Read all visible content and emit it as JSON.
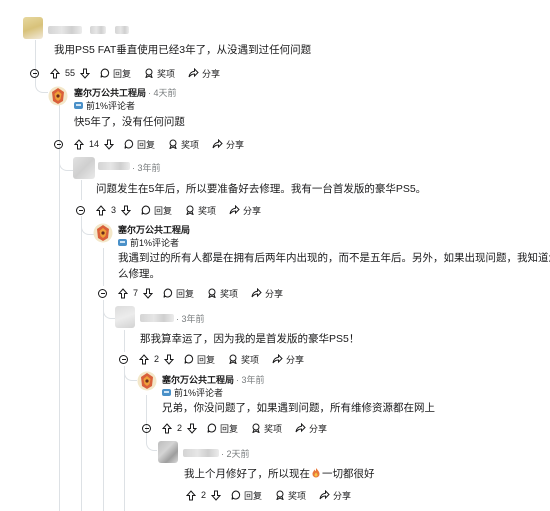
{
  "labels": {
    "reply": "回复",
    "award": "奖项",
    "share": "分享"
  },
  "comments": [
    {
      "id": "c1",
      "user": "",
      "time": "",
      "badge": "",
      "text": "我用PS5 FAT垂直使用已经3年了，从没遇到过任何问题",
      "votes": "55"
    },
    {
      "id": "c2",
      "user": "塞尔万公共工程局",
      "time": "· 4天前",
      "badge": "前1%评论者",
      "text": "快5年了，没有任何问题",
      "votes": "14"
    },
    {
      "id": "c3",
      "user": "",
      "time": "· 3年前",
      "badge": "",
      "text": "问题发生在5年后，所以要准备好去修理。我有一台首发版的豪华PS5。",
      "votes": "3"
    },
    {
      "id": "c4",
      "user": "塞尔万公共工程局",
      "time": "",
      "badge": "前1%评论者",
      "text_line1": "我遇到过的所有人都是在拥有后两年内出现的，而不是五年后。另外，如果出现问题，我知道怎",
      "text_line2": "么修理。",
      "votes": "7"
    },
    {
      "id": "c5",
      "user": "",
      "time": "· 3年前",
      "badge": "",
      "text": "那我算幸运了，因为我的是首发版的豪华PS5！",
      "votes": "2"
    },
    {
      "id": "c6",
      "user": "塞尔万公共工程局",
      "time": "· 3年前",
      "badge": "前1%评论者",
      "text": "兄弟，你没问题了，如果遇到问题，所有维修资源都在网上",
      "votes": "2"
    },
    {
      "id": "c7",
      "user": "",
      "time": "· 2天前",
      "badge": "",
      "text_a": "我上个月修好了，所以现在",
      "text_b": "一切都很好",
      "votes": "2"
    }
  ],
  "colors": {
    "accent": "#4a90c8",
    "thread": "#dde1e5",
    "muted": "#787c7e",
    "fire": "#e8773a"
  }
}
